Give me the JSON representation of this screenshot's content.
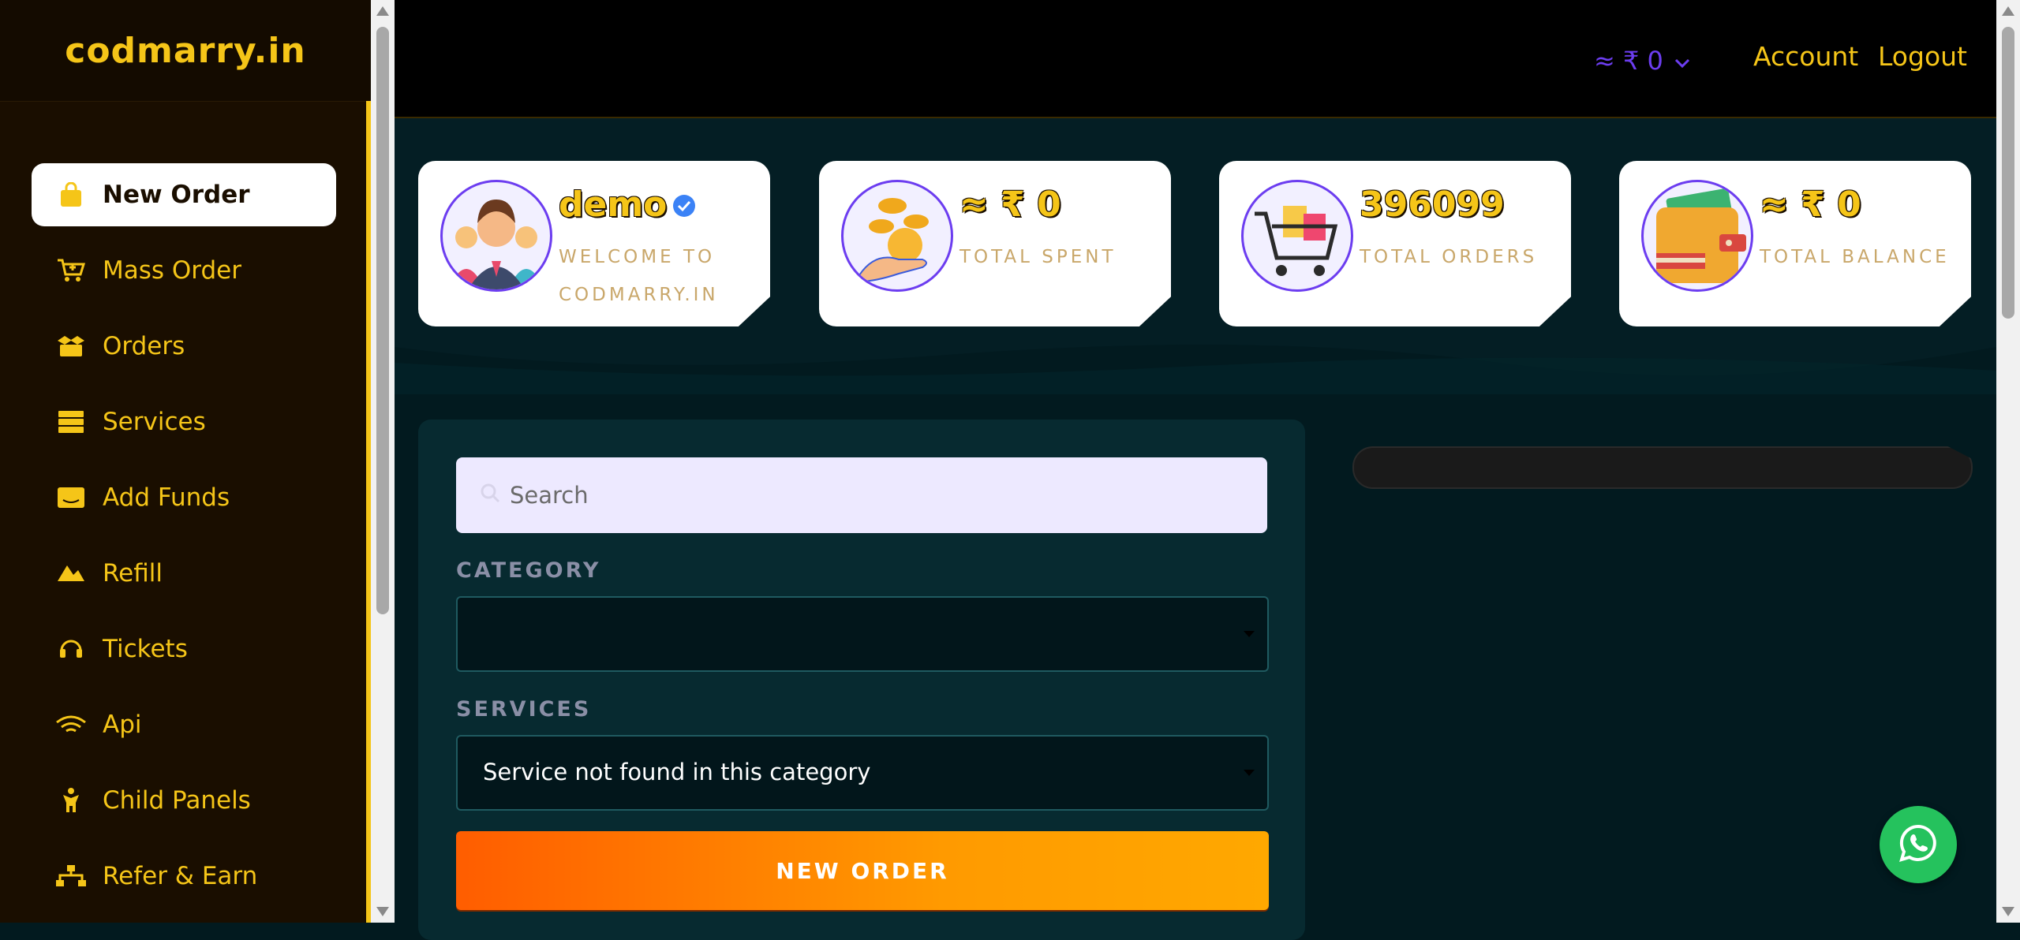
{
  "brand": {
    "name": "codmarry.in",
    "color": "#f5c518"
  },
  "sidebar": {
    "items": [
      {
        "label": "New Order",
        "icon": "shopping-bag-icon",
        "active": true
      },
      {
        "label": "Mass Order",
        "icon": "cart-plus-icon"
      },
      {
        "label": "Orders",
        "icon": "box-open-icon"
      },
      {
        "label": "Services",
        "icon": "server-list-icon"
      },
      {
        "label": "Add Funds",
        "icon": "wallet-icon"
      },
      {
        "label": "Refill",
        "icon": "refill-arrow-icon"
      },
      {
        "label": "Tickets",
        "icon": "headset-icon"
      },
      {
        "label": "Api",
        "icon": "wifi-api-icon"
      },
      {
        "label": "Child Panels",
        "icon": "child-icon"
      },
      {
        "label": "Refer & Earn",
        "icon": "network-icon"
      }
    ]
  },
  "topbar": {
    "currency": "≈ ₹ 0",
    "account_label": "Account",
    "logout_label": "Logout",
    "accent": "#6c3df0"
  },
  "stats": {
    "user": {
      "value": "demo",
      "label_line1": "WELCOME TO",
      "label_line2": "CODMARRY.IN"
    },
    "spent": {
      "value": "≈ ₹ 0",
      "label": "TOTAL SPENT"
    },
    "orders": {
      "value": "396099",
      "label": "TOTAL ORDERS"
    },
    "balance": {
      "value": "≈ ₹ 0",
      "label": "TOTAL BALANCE"
    }
  },
  "form": {
    "search_placeholder": "Search",
    "category_label": "CATEGORY",
    "category_value": "",
    "services_label": "SERVICES",
    "services_value": "Service not found in this category",
    "submit_label": "NEW ORDER"
  }
}
